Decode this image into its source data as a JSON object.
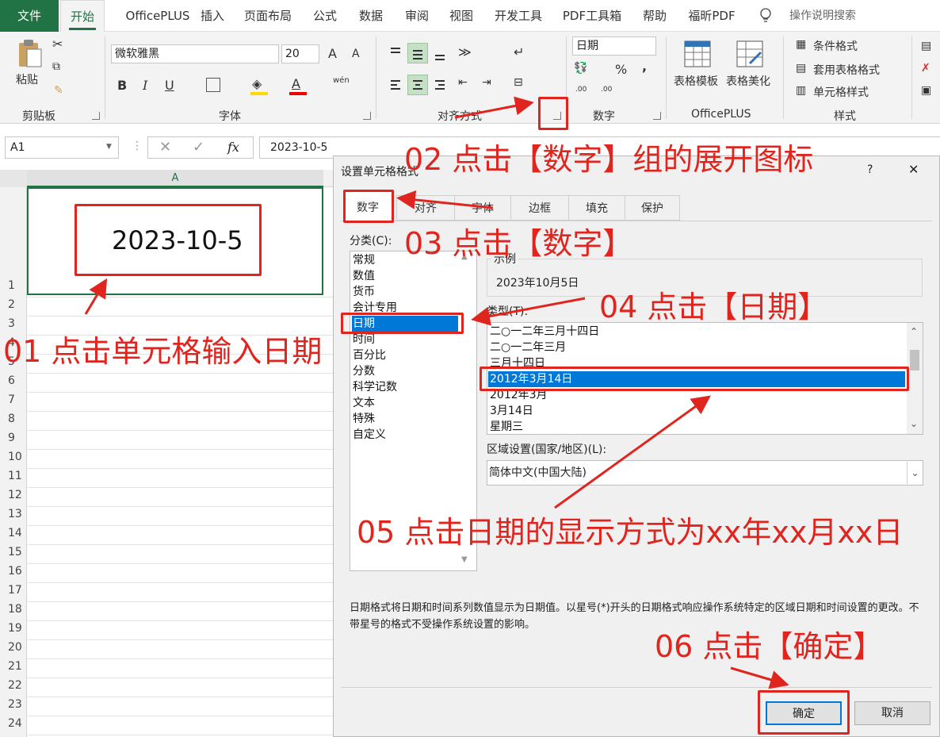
{
  "tabs": [
    "文件",
    "开始",
    "OfficePLUS",
    "插入",
    "页面布局",
    "公式",
    "数据",
    "审阅",
    "视图",
    "开发工具",
    "PDF工具箱",
    "帮助",
    "福昕PDF"
  ],
  "tell_me": "操作说明搜索",
  "ribbon": {
    "clipboard": {
      "paste": "粘贴",
      "group": "剪贴板"
    },
    "font": {
      "name": "微软雅黑",
      "size": "20",
      "grow": "A",
      "shrink": "A",
      "bold": "B",
      "italic": "I",
      "underline": "U",
      "color_a": "A",
      "phonetic": "wén",
      "group": "字体"
    },
    "align": {
      "group": "对齐方式"
    },
    "number": {
      "format": "日期",
      "percent": "%",
      "comma": ",",
      "inc": ".00",
      "dec": ".00",
      "group": "数字"
    },
    "officeplus": {
      "template": "表格模板",
      "beautify": "表格美化",
      "group": "OfficePLUS"
    },
    "styles": {
      "cond": "条件格式",
      "table": "套用表格格式",
      "cell": "单元格样式",
      "group": "样式"
    }
  },
  "formula_bar": {
    "name_box": "A1",
    "fx": "fx",
    "value": "2023-10-5"
  },
  "sheet": {
    "col": "A",
    "cell_value": "2023-10-5",
    "rows": [
      "1",
      "2",
      "3",
      "4",
      "5",
      "6",
      "7",
      "8",
      "9",
      "10",
      "11",
      "12",
      "13",
      "14",
      "15",
      "16",
      "17",
      "18",
      "19",
      "20",
      "21",
      "22",
      "23",
      "24"
    ]
  },
  "dialog": {
    "title": "设置单元格格式",
    "help": "?",
    "close": "✕",
    "tabs": [
      "数字",
      "对齐",
      "字体",
      "边框",
      "填充",
      "保护"
    ],
    "category_label": "分类(C):",
    "categories": [
      "常规",
      "数值",
      "货币",
      "会计专用",
      "日期",
      "时间",
      "百分比",
      "分数",
      "科学记数",
      "文本",
      "特殊",
      "自定义"
    ],
    "sample_label": "示例",
    "sample_value": "2023年10月5日",
    "type_label": "类型(T):",
    "types": [
      "二○一二年三月十四日",
      "二○一二年三月",
      "三月十四日",
      "2012年3月14日",
      "2012年3月",
      "3月14日",
      "星期三"
    ],
    "locale_label": "区域设置(国家/地区)(L):",
    "locale_value": "简体中文(中国大陆)",
    "description": "日期格式将日期和时间系列数值显示为日期值。以星号(*)开头的日期格式响应操作系统特定的区域日期和时间设置的更改。不带星号的格式不受操作系统设置的影响。",
    "ok": "确定",
    "cancel": "取消"
  },
  "annotations": {
    "a1": "01 点击单元格输入日期",
    "a2": "02 点击【数字】组的展开图标",
    "a3": "03 点击【数字】",
    "a4": "04 点击【日期】",
    "a5": "05 点击日期的显示方式为xx年xx月xx日",
    "a6": "06 点击【确定】"
  },
  "colors": {
    "accent": "#217346",
    "annotation": "#e0251f",
    "selection": "#0078d7"
  }
}
